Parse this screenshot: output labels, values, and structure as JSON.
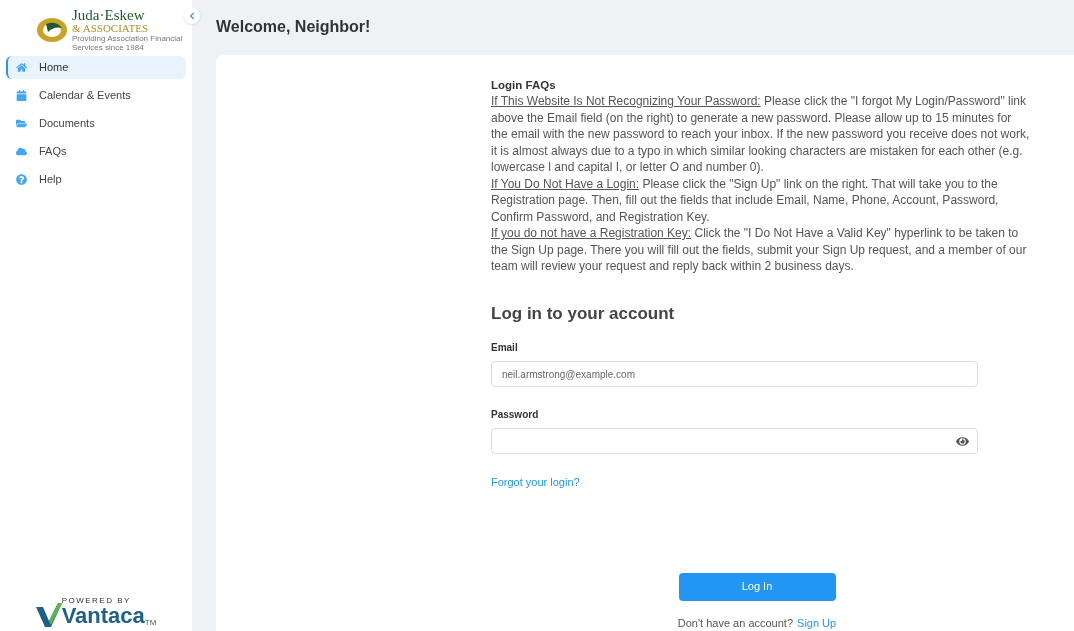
{
  "logo": {
    "name": "Juda·Eskew",
    "subtitle": "& ASSOCIATES",
    "tagline": "Providing Association Financial Services since 1984"
  },
  "sidebar": {
    "items": [
      {
        "label": "Home",
        "kind": "home",
        "selected": true
      },
      {
        "label": "Calendar & Events",
        "kind": "calendar",
        "selected": false
      },
      {
        "label": "Documents",
        "kind": "folder",
        "selected": false
      },
      {
        "label": "FAQs",
        "kind": "cloud",
        "selected": false
      },
      {
        "label": "Help",
        "kind": "help",
        "selected": false
      }
    ]
  },
  "powered_by": {
    "caption": "POWERED BY",
    "brand": "Vantaca",
    "trademark": "TM"
  },
  "page_title": "Welcome, Neighbor!",
  "faq": {
    "title": "Login FAQs",
    "items": [
      {
        "lead": "If This Website Is Not Recognizing Your Password:",
        "text": " Please click the \"I forgot My Login/Password\" link above the Email field (on the right) to generate a new password. Please allow up to 15 minutes for the email with the new password to reach your inbox. If the new password you receive does not work, it is almost always due to a typo in which similar looking characters are mistaken for each other (e.g. lowercase l and capital I, or letter O and number 0)."
      },
      {
        "lead": "If You Do Not Have a Login:",
        "text": " Please click the \"Sign Up\" link on the right. That will take you to the Registration page. Then, fill out the fields that include Email, Name, Phone, Account, Password, Confirm Password, and Registration Key."
      },
      {
        "lead": "If you do not have a Registration Key:",
        "text": " Click the \"I Do Not Have a Valid Key\" hyperlink to be taken to the Sign Up page. There you will fill out the fields, submit your Sign Up request, and a member of our team will review your request and reply back within 2 business days."
      }
    ]
  },
  "login": {
    "title": "Log in to your account",
    "email": {
      "label": "Email",
      "placeholder": "neil.armstrong@example.com"
    },
    "password": {
      "label": "Password"
    },
    "forgot_link": "Forgot your login?",
    "submit": "Log In",
    "signup_prompt": "Don't have an account?",
    "signup_link": "Sign Up"
  }
}
